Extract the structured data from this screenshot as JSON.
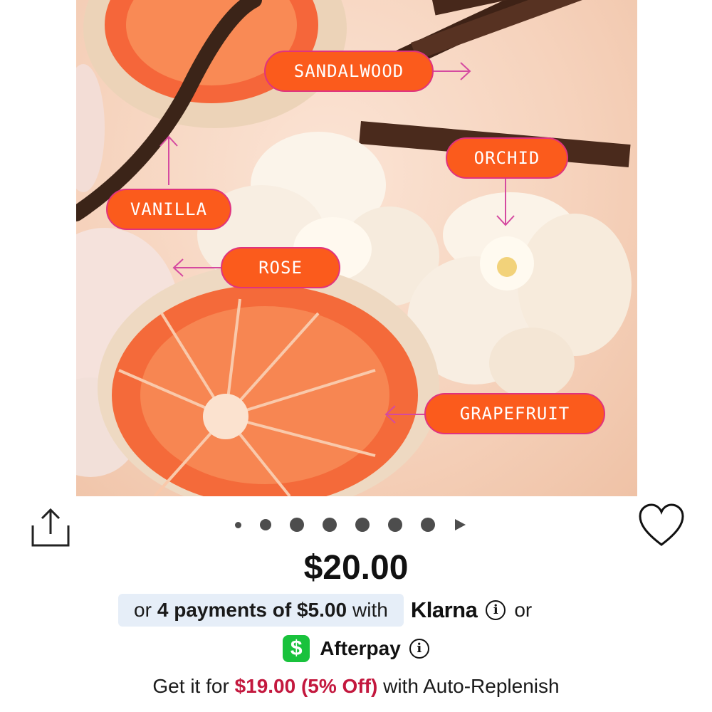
{
  "product_image": {
    "notes": [
      {
        "id": "sandalwood",
        "label": "SANDALWOOD"
      },
      {
        "id": "orchid",
        "label": "ORCHID"
      },
      {
        "id": "vanilla",
        "label": "VANILLA"
      },
      {
        "id": "rose",
        "label": "ROSE"
      },
      {
        "id": "grapefruit",
        "label": "GRAPEFRUIT"
      }
    ],
    "colors": {
      "label_bg": "#fb5b1c",
      "label_border": "#e0337e",
      "arrow": "#d54aa0"
    }
  },
  "carousel": {
    "total_dots": 7,
    "next_icon": "play-triangle-icon"
  },
  "actions": {
    "share_icon": "share-icon",
    "favorite_icon": "heart-icon"
  },
  "price": "$20.00",
  "payments": {
    "or_prefix": "or",
    "installments": "4 payments of $5.00",
    "with": "with",
    "klarna": "Klarna",
    "or_suffix": "or",
    "afterpay": "Afterpay",
    "cashapp_icon": "$"
  },
  "replenish": {
    "prefix": "Get it for",
    "discount": "$19.00 (5% Off)",
    "suffix": "with Auto-Replenish"
  }
}
